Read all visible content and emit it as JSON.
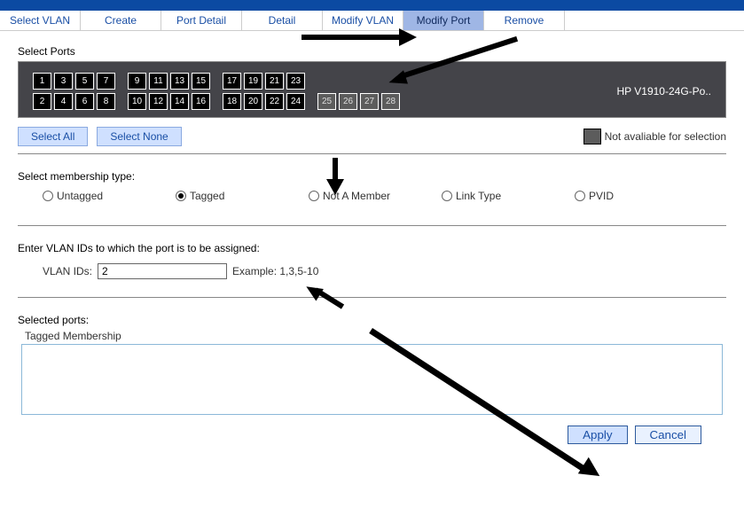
{
  "tabs": {
    "select_vlan": "Select VLAN",
    "create": "Create",
    "port_detail": "Port Detail",
    "detail": "Detail",
    "modify_vlan": "Modify VLAN",
    "modify_port": "Modify Port",
    "remove": "Remove"
  },
  "labels": {
    "select_ports": "Select Ports",
    "device": "HP V1910-24G-Po..",
    "select_all": "Select All",
    "select_none": "Select None",
    "not_avail": "Not avaliable for selection",
    "membership_title": "Select membership type:",
    "enter_vlan": "Enter VLAN IDs to which the port is to be assigned:",
    "vlan_ids": "VLAN IDs:",
    "example": "Example: 1,3,5-10",
    "selected_ports": "Selected ports:",
    "tagged_membership": "Tagged Membership",
    "apply": "Apply",
    "cancel": "Cancel"
  },
  "membership": {
    "untagged": "Untagged",
    "tagged": "Tagged",
    "not_member": "Not A Member",
    "link_type": "Link Type",
    "pvid": "PVID"
  },
  "vlan_value": "2",
  "ports_top": [
    "1",
    "3",
    "5",
    "7",
    "9",
    "11",
    "13",
    "15",
    "17",
    "19",
    "21",
    "23"
  ],
  "ports_bottom": [
    "2",
    "4",
    "6",
    "8",
    "10",
    "12",
    "14",
    "16",
    "18",
    "20",
    "22",
    "24"
  ],
  "ports_na": [
    "25",
    "26",
    "27",
    "28"
  ]
}
